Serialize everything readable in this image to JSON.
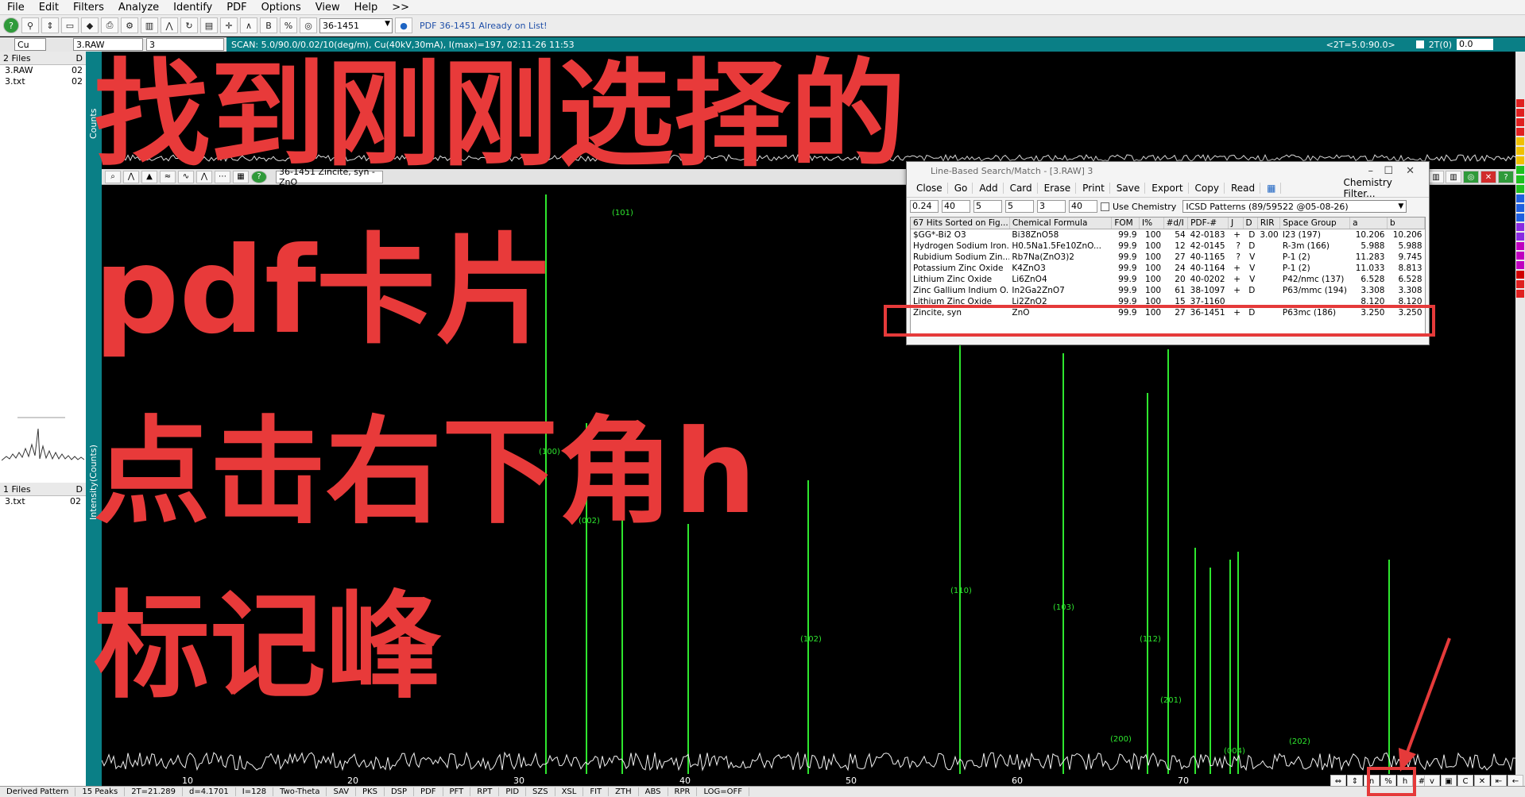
{
  "menu": [
    "File",
    "Edit",
    "Filters",
    "Analyze",
    "Identify",
    "PDF",
    "Options",
    "View",
    "Help",
    ">>"
  ],
  "toolbar": {
    "pdf_select": "36-1451",
    "pdf_message": "PDF 36-1451 Already on List!"
  },
  "bar2": {
    "element": "Cu",
    "file": "3.RAW",
    "field": "3",
    "scan_info": "SCAN: 5.0/90.0/0.02/10(deg/m), Cu(40kV,30mA), I(max)=197, 02:11-26 11:53",
    "twotheta_info": "<2T=5.0:90.0>",
    "twotheta_label": "2T(0)",
    "twotheta_value": "0.0"
  },
  "left_panel": {
    "top_header": "2 Files",
    "top_header_d": "D",
    "top_files": [
      {
        "name": "3.RAW",
        "col": "02"
      },
      {
        "name": "3.txt",
        "col": "02"
      }
    ],
    "bottom_header": "1 Files",
    "bottom_header_d": "D",
    "bottom_files": [
      {
        "name": "3.txt",
        "col": "02"
      }
    ]
  },
  "vstrip": {
    "top_label": "Counts",
    "bottom_label": "Intensity(Counts)"
  },
  "pattern_toolbar": {
    "field_text": "36-1451 Zincite, syn - ZnO"
  },
  "dialog": {
    "title": "Line-Based Search/Match - [3.RAW] 3",
    "buttons": [
      "Close",
      "Go",
      "Add",
      "Card",
      "Erase",
      "Print",
      "Save",
      "Export",
      "Copy",
      "Read"
    ],
    "chem_filter": "Chemistry Filter...",
    "spins": [
      "0.24",
      "40",
      "5",
      "5",
      "3",
      "40"
    ],
    "use_chem": "Use Chemistry",
    "db": "ICSD Patterns (89/59522 @05-08-26)",
    "headers": [
      "67 Hits Sorted on Fig...",
      "Chemical Formula",
      "FOM",
      "I%",
      "#d/I",
      "PDF-#",
      "J",
      "D",
      "RIR",
      "Space Group",
      "a",
      "b"
    ],
    "rows": [
      [
        "$GG*-Bi2 O3",
        "Bi38ZnO58",
        "99.9",
        "100",
        "54",
        "42-0183",
        "+",
        "D",
        "3.00",
        "I23 (197)",
        "10.206",
        "10.206"
      ],
      [
        "Hydrogen Sodium Iron...",
        "H0.5Na1.5Fe10ZnO...",
        "99.9",
        "100",
        "12",
        "42-0145",
        "?",
        "D",
        "",
        "R-3m (166)",
        "5.988",
        "5.988"
      ],
      [
        "Rubidium Sodium Zin...",
        "Rb7Na(ZnO3)2",
        "99.9",
        "100",
        "27",
        "40-1165",
        "?",
        "V",
        "",
        "P-1 (2)",
        "11.283",
        "9.745"
      ],
      [
        "Potassium Zinc Oxide",
        "K4ZnO3",
        "99.9",
        "100",
        "24",
        "40-1164",
        "+",
        "V",
        "",
        "P-1 (2)",
        "11.033",
        "8.813"
      ],
      [
        "Lithium Zinc Oxide",
        "Li6ZnO4",
        "99.9",
        "100",
        "20",
        "40-0202",
        "+",
        "V",
        "",
        "P42/nmc (137)",
        "6.528",
        "6.528"
      ],
      [
        "Zinc Gallium Indium O...",
        "In2Ga2ZnO7",
        "99.9",
        "100",
        "61",
        "38-1097",
        "+",
        "D",
        "",
        "P63/mmc (194)",
        "3.308",
        "3.308"
      ],
      [
        "Lithium Zinc Oxide",
        "Li2ZnO2",
        "99.9",
        "100",
        "15",
        "37-1160",
        "",
        "",
        "",
        "",
        "8.120",
        "8.120"
      ],
      [
        "Zincite, syn",
        "ZnO",
        "99.9",
        "100",
        "27",
        "36-1451",
        "+",
        "D",
        "",
        "P63mc (186)",
        "3.250",
        "3.250"
      ]
    ]
  },
  "overlay_text": {
    "line1": "找到刚刚选择的",
    "line2": "pdf卡片",
    "line3": "点击右下角h",
    "line4": "标记峰"
  },
  "peak_labels": [
    {
      "text": "(101)"
    },
    {
      "text": "(100)"
    },
    {
      "text": "(002)"
    },
    {
      "text": "(102)"
    },
    {
      "text": "(110)"
    },
    {
      "text": "(103)"
    },
    {
      "text": "(112)"
    },
    {
      "text": "(201)"
    },
    {
      "text": "(200)"
    },
    {
      "text": "(004)"
    },
    {
      "text": "(202)"
    }
  ],
  "x_ticks": [
    "10",
    "20",
    "30",
    "40",
    "50",
    "60",
    "70"
  ],
  "status": [
    "Derived Pattern",
    "15 Peaks",
    "2T=21.289",
    "d=4.1701",
    "I=128",
    "Two-Theta",
    "SAV",
    "PKS",
    "DSP",
    "PDF",
    "PFT",
    "RPT",
    "PID",
    "SZS",
    "XSL",
    "FIT",
    "ZTH",
    "ABS",
    "RPR",
    "LOG=OFF"
  ],
  "colors": {
    "teal": "#0a7f86",
    "annotation_red": "#e83a3a",
    "peak_green": "#2ee62e"
  }
}
